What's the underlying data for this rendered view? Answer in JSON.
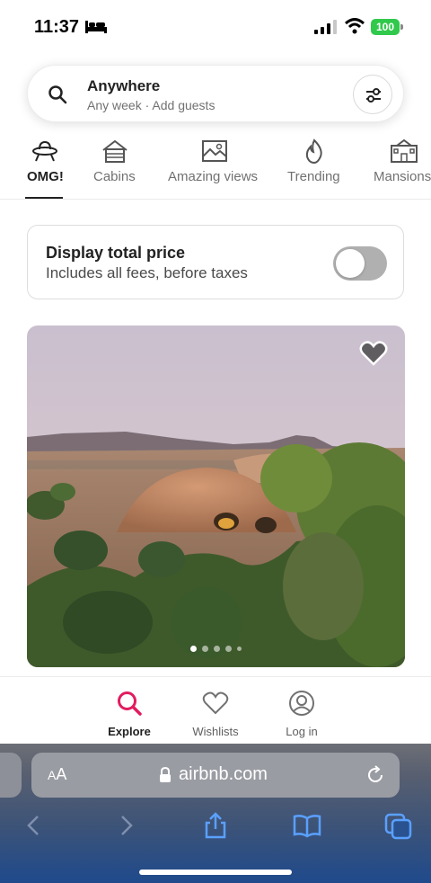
{
  "status_bar": {
    "time": "11:37",
    "battery": "100"
  },
  "search": {
    "title": "Anywhere",
    "subtitle_week": "Any week",
    "separator": "·",
    "subtitle_guests": "Add guests",
    "icon": "search-icon",
    "filter_icon": "sliders-icon"
  },
  "categories": [
    {
      "label": "OMG!",
      "icon": "ufo-icon",
      "active": true
    },
    {
      "label": "Cabins",
      "icon": "cabin-icon",
      "active": false
    },
    {
      "label": "Amazing views",
      "icon": "view-icon",
      "active": false
    },
    {
      "label": "Trending",
      "icon": "flame-icon",
      "active": false
    },
    {
      "label": "Mansions",
      "icon": "mansion-icon",
      "active": false
    }
  ],
  "price_toggle": {
    "title": "Display total price",
    "subtitle": "Includes all fees, before taxes",
    "enabled": false
  },
  "listing": {
    "photo_count": 5,
    "active_photo": 1,
    "wishlist_icon": "heart-icon"
  },
  "tabbar": {
    "explore": "Explore",
    "wishlists": "Wishlists",
    "login": "Log in"
  },
  "safari": {
    "aa": "AA",
    "url": "airbnb.com"
  },
  "colors": {
    "brand": "#E31C5F",
    "text": "#222222",
    "muted": "#717171",
    "battery": "#30C94B"
  }
}
